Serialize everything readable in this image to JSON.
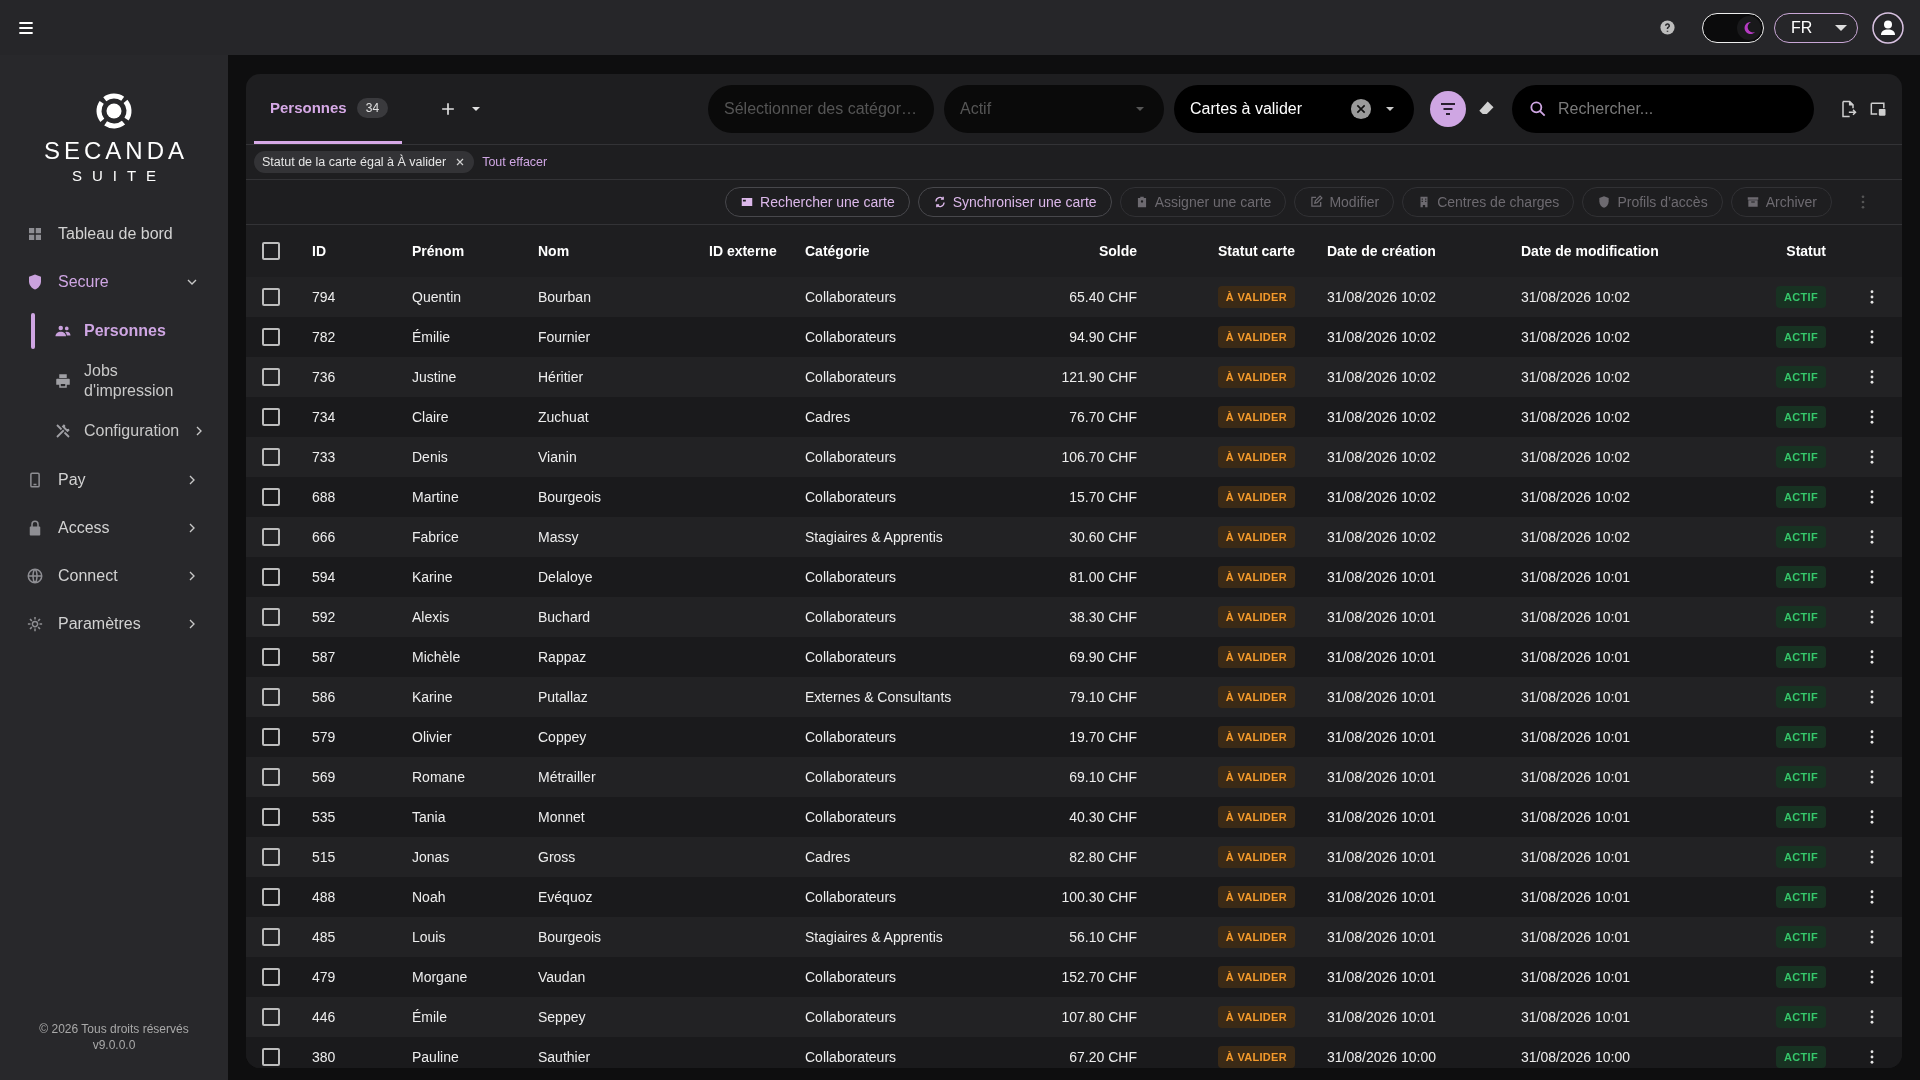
{
  "topbar": {
    "dark_mode": true,
    "language": "FR"
  },
  "sidebar": {
    "logo": {
      "name": "SECANDA",
      "subtitle": "SUITE"
    },
    "items": [
      {
        "label": "Tableau de bord",
        "selected": false
      },
      {
        "label": "Secure",
        "selected": true,
        "expanded": true,
        "children": [
          {
            "label": "Personnes",
            "selected": true
          },
          {
            "label": "Jobs d'impression",
            "selected": false
          },
          {
            "label": "Configuration",
            "selected": false,
            "expanded": false
          }
        ]
      },
      {
        "label": "Pay",
        "selected": false,
        "expanded": false
      },
      {
        "label": "Access",
        "selected": false,
        "expanded": false
      },
      {
        "label": "Connect",
        "selected": false,
        "expanded": false
      },
      {
        "label": "Paramètres",
        "selected": false,
        "expanded": false
      }
    ],
    "footer": [
      "© 2026 Tous droits réservés",
      "v9.0.0.0"
    ]
  },
  "tabs": [
    {
      "label": "Personnes",
      "count": "34",
      "selected": true
    }
  ],
  "filters": {
    "category": {
      "placeholder": "Sélectionner des catégor…"
    },
    "status": {
      "value": "Actif",
      "disabled": true
    },
    "view": {
      "value": "Cartes à valider"
    },
    "search": {
      "placeholder": "Rechercher..."
    }
  },
  "active_filters": {
    "chips": [
      "Statut de la carte égal à À valider"
    ],
    "clear_all": "Tout effacer"
  },
  "actions": [
    {
      "label": "Rechercher une carte",
      "disabled": false
    },
    {
      "label": "Synchroniser une carte",
      "disabled": false
    },
    {
      "label": "Assigner une carte",
      "disabled": true
    },
    {
      "label": "Modifier",
      "disabled": true
    },
    {
      "label": "Centres de charges",
      "disabled": true
    },
    {
      "label": "Profils d’accès",
      "disabled": true
    },
    {
      "label": "Archiver",
      "disabled": true
    }
  ],
  "table": {
    "all_checked": false,
    "columns": [
      "ID",
      "Prénom",
      "Nom",
      "ID externe",
      "Catégorie",
      "Solde",
      "Statut carte",
      "Date de création",
      "Date de modification",
      "Statut"
    ],
    "rows": [
      {
        "selected": false,
        "id": "794",
        "first_name": "Quentin",
        "last_name": "Bourban",
        "category": "Collaborateurs",
        "balance": "65.40 CHF",
        "card_status": "À VALIDER",
        "created": "31/08/2026 10:02",
        "modified": "31/08/2026 10:02",
        "status": "ACTIF"
      },
      {
        "selected": false,
        "id": "782",
        "first_name": "Émilie",
        "last_name": "Fournier",
        "category": "Collaborateurs",
        "balance": "94.90 CHF",
        "card_status": "À VALIDER",
        "created": "31/08/2026 10:02",
        "modified": "31/08/2026 10:02",
        "status": "ACTIF"
      },
      {
        "selected": false,
        "id": "736",
        "first_name": "Justine",
        "last_name": "Héritier",
        "category": "Collaborateurs",
        "balance": "121.90 CHF",
        "card_status": "À VALIDER",
        "created": "31/08/2026 10:02",
        "modified": "31/08/2026 10:02",
        "status": "ACTIF"
      },
      {
        "selected": false,
        "id": "734",
        "first_name": "Claire",
        "last_name": "Zuchuat",
        "category": "Cadres",
        "balance": "76.70 CHF",
        "card_status": "À VALIDER",
        "created": "31/08/2026 10:02",
        "modified": "31/08/2026 10:02",
        "status": "ACTIF"
      },
      {
        "selected": false,
        "id": "733",
        "first_name": "Denis",
        "last_name": "Vianin",
        "category": "Collaborateurs",
        "balance": "106.70 CHF",
        "card_status": "À VALIDER",
        "created": "31/08/2026 10:02",
        "modified": "31/08/2026 10:02",
        "status": "ACTIF"
      },
      {
        "selected": false,
        "id": "688",
        "first_name": "Martine",
        "last_name": "Bourgeois",
        "category": "Collaborateurs",
        "balance": "15.70 CHF",
        "card_status": "À VALIDER",
        "created": "31/08/2026 10:02",
        "modified": "31/08/2026 10:02",
        "status": "ACTIF"
      },
      {
        "selected": false,
        "id": "666",
        "first_name": "Fabrice",
        "last_name": "Massy",
        "category": "Stagiaires & Apprentis",
        "balance": "30.60 CHF",
        "card_status": "À VALIDER",
        "created": "31/08/2026 10:02",
        "modified": "31/08/2026 10:02",
        "status": "ACTIF"
      },
      {
        "selected": false,
        "id": "594",
        "first_name": "Karine",
        "last_name": "Delaloye",
        "category": "Collaborateurs",
        "balance": "81.00 CHF",
        "card_status": "À VALIDER",
        "created": "31/08/2026 10:01",
        "modified": "31/08/2026 10:01",
        "status": "ACTIF"
      },
      {
        "selected": false,
        "id": "592",
        "first_name": "Alexis",
        "last_name": "Buchard",
        "category": "Collaborateurs",
        "balance": "38.30 CHF",
        "card_status": "À VALIDER",
        "created": "31/08/2026 10:01",
        "modified": "31/08/2026 10:01",
        "status": "ACTIF"
      },
      {
        "selected": false,
        "id": "587",
        "first_name": "Michèle",
        "last_name": "Rappaz",
        "category": "Collaborateurs",
        "balance": "69.90 CHF",
        "card_status": "À VALIDER",
        "created": "31/08/2026 10:01",
        "modified": "31/08/2026 10:01",
        "status": "ACTIF"
      },
      {
        "selected": false,
        "id": "586",
        "first_name": "Karine",
        "last_name": "Putallaz",
        "category": "Externes & Consultants",
        "balance": "79.10 CHF",
        "card_status": "À VALIDER",
        "created": "31/08/2026 10:01",
        "modified": "31/08/2026 10:01",
        "status": "ACTIF"
      },
      {
        "selected": false,
        "id": "579",
        "first_name": "Olivier",
        "last_name": "Coppey",
        "category": "Collaborateurs",
        "balance": "19.70 CHF",
        "card_status": "À VALIDER",
        "created": "31/08/2026 10:01",
        "modified": "31/08/2026 10:01",
        "status": "ACTIF"
      },
      {
        "selected": false,
        "id": "569",
        "first_name": "Romane",
        "last_name": "Métrailler",
        "category": "Collaborateurs",
        "balance": "69.10 CHF",
        "card_status": "À VALIDER",
        "created": "31/08/2026 10:01",
        "modified": "31/08/2026 10:01",
        "status": "ACTIF"
      },
      {
        "selected": false,
        "id": "535",
        "first_name": "Tania",
        "last_name": "Monnet",
        "category": "Collaborateurs",
        "balance": "40.30 CHF",
        "card_status": "À VALIDER",
        "created": "31/08/2026 10:01",
        "modified": "31/08/2026 10:01",
        "status": "ACTIF"
      },
      {
        "selected": false,
        "id": "515",
        "first_name": "Jonas",
        "last_name": "Gross",
        "category": "Cadres",
        "balance": "82.80 CHF",
        "card_status": "À VALIDER",
        "created": "31/08/2026 10:01",
        "modified": "31/08/2026 10:01",
        "status": "ACTIF"
      },
      {
        "selected": false,
        "id": "488",
        "first_name": "Noah",
        "last_name": "Evéquoz",
        "category": "Collaborateurs",
        "balance": "100.30 CHF",
        "card_status": "À VALIDER",
        "created": "31/08/2026 10:01",
        "modified": "31/08/2026 10:01",
        "status": "ACTIF"
      },
      {
        "selected": false,
        "id": "485",
        "first_name": "Louis",
        "last_name": "Bourgeois",
        "category": "Stagiaires & Apprentis",
        "balance": "56.10 CHF",
        "card_status": "À VALIDER",
        "created": "31/08/2026 10:01",
        "modified": "31/08/2026 10:01",
        "status": "ACTIF"
      },
      {
        "selected": false,
        "id": "479",
        "first_name": "Morgane",
        "last_name": "Vaudan",
        "category": "Collaborateurs",
        "balance": "152.70 CHF",
        "card_status": "À VALIDER",
        "created": "31/08/2026 10:01",
        "modified": "31/08/2026 10:01",
        "status": "ACTIF"
      },
      {
        "selected": false,
        "id": "446",
        "first_name": "Émile",
        "last_name": "Seppey",
        "category": "Collaborateurs",
        "balance": "107.80 CHF",
        "card_status": "À VALIDER",
        "created": "31/08/2026 10:01",
        "modified": "31/08/2026 10:01",
        "status": "ACTIF"
      },
      {
        "selected": false,
        "id": "380",
        "first_name": "Pauline",
        "last_name": "Sauthier",
        "category": "Collaborateurs",
        "balance": "67.20 CHF",
        "card_status": "À VALIDER",
        "created": "31/08/2026 10:00",
        "modified": "31/08/2026 10:00",
        "status": "ACTIF"
      }
    ]
  }
}
